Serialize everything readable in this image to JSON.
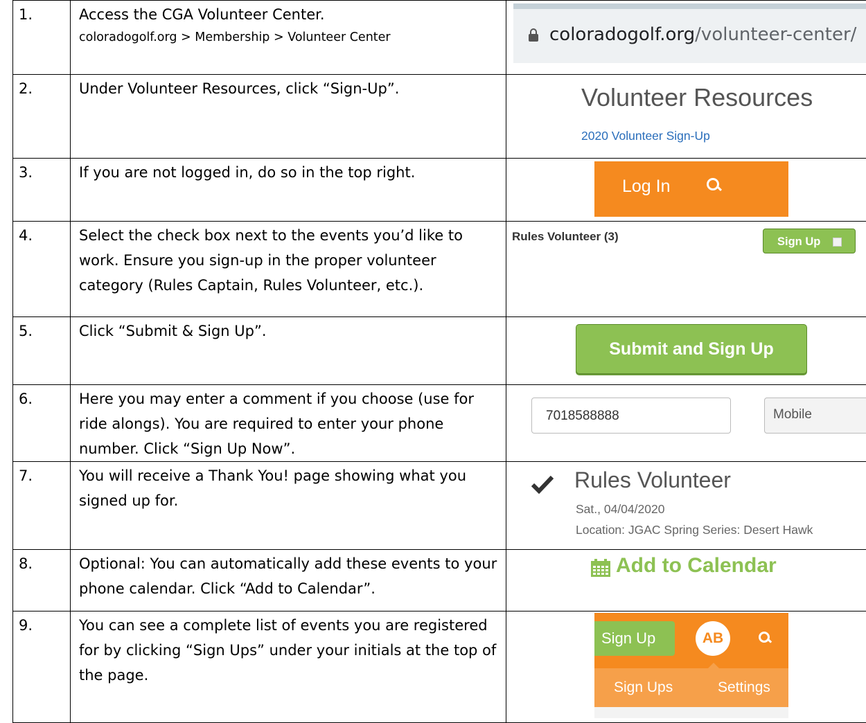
{
  "steps": [
    {
      "num": "1.",
      "text": "Access the CGA Volunteer Center.",
      "sub": "coloradogolf.org > Membership > Volunteer Center"
    },
    {
      "num": "2.",
      "text": "Under Volunteer Resources, click “Sign-Up”."
    },
    {
      "num": "3.",
      "text": "If you are not logged in, do so in the top right."
    },
    {
      "num": "4.",
      "text": "Select the check box next to the events you’d like to work. Ensure you sign-up in the proper volunteer category (Rules Captain, Rules Volunteer, etc.)."
    },
    {
      "num": "5.",
      "text": "Click “Submit & Sign Up”."
    },
    {
      "num": "6.",
      "text": "Here you may enter a comment if you choose (use for ride alongs). You are required to enter your phone number. Click “Sign Up Now”."
    },
    {
      "num": "7.",
      "text": "You will receive a Thank You! page showing what you signed up for."
    },
    {
      "num": "8.",
      "text": "Optional: You can automatically add these events to your phone calendar. Click “Add to Calendar”."
    },
    {
      "num": "9.",
      "text": "You can see a complete list of events you are registered for by clicking “Sign Ups” under your initials at the top of the page."
    }
  ],
  "shots": {
    "url": {
      "domain": "coloradogolf.org",
      "path": "/volunteer-center/"
    },
    "resources": {
      "title": "Volunteer Resources",
      "link": "2020 Volunteer Sign-Up"
    },
    "login": {
      "label": "Log In"
    },
    "rules": {
      "category": "Rules Volunteer (3)",
      "button": "Sign Up"
    },
    "submit": {
      "label": "Submit and Sign Up"
    },
    "phone": {
      "value": "7018588888",
      "type": "Mobile"
    },
    "thanks": {
      "title": "Rules Volunteer",
      "date": "Sat., 04/04/2020",
      "location": "Location: JGAC Spring Series: Desert Hawk"
    },
    "calendar": {
      "label": "Add to Calendar"
    },
    "nav": {
      "signup": "Sign Up",
      "initials": "AB",
      "signups": "Sign Ups",
      "settings": "Settings"
    }
  },
  "colors": {
    "orange": "#f58a1f",
    "green": "#8dc153",
    "link": "#2a6ebb"
  }
}
